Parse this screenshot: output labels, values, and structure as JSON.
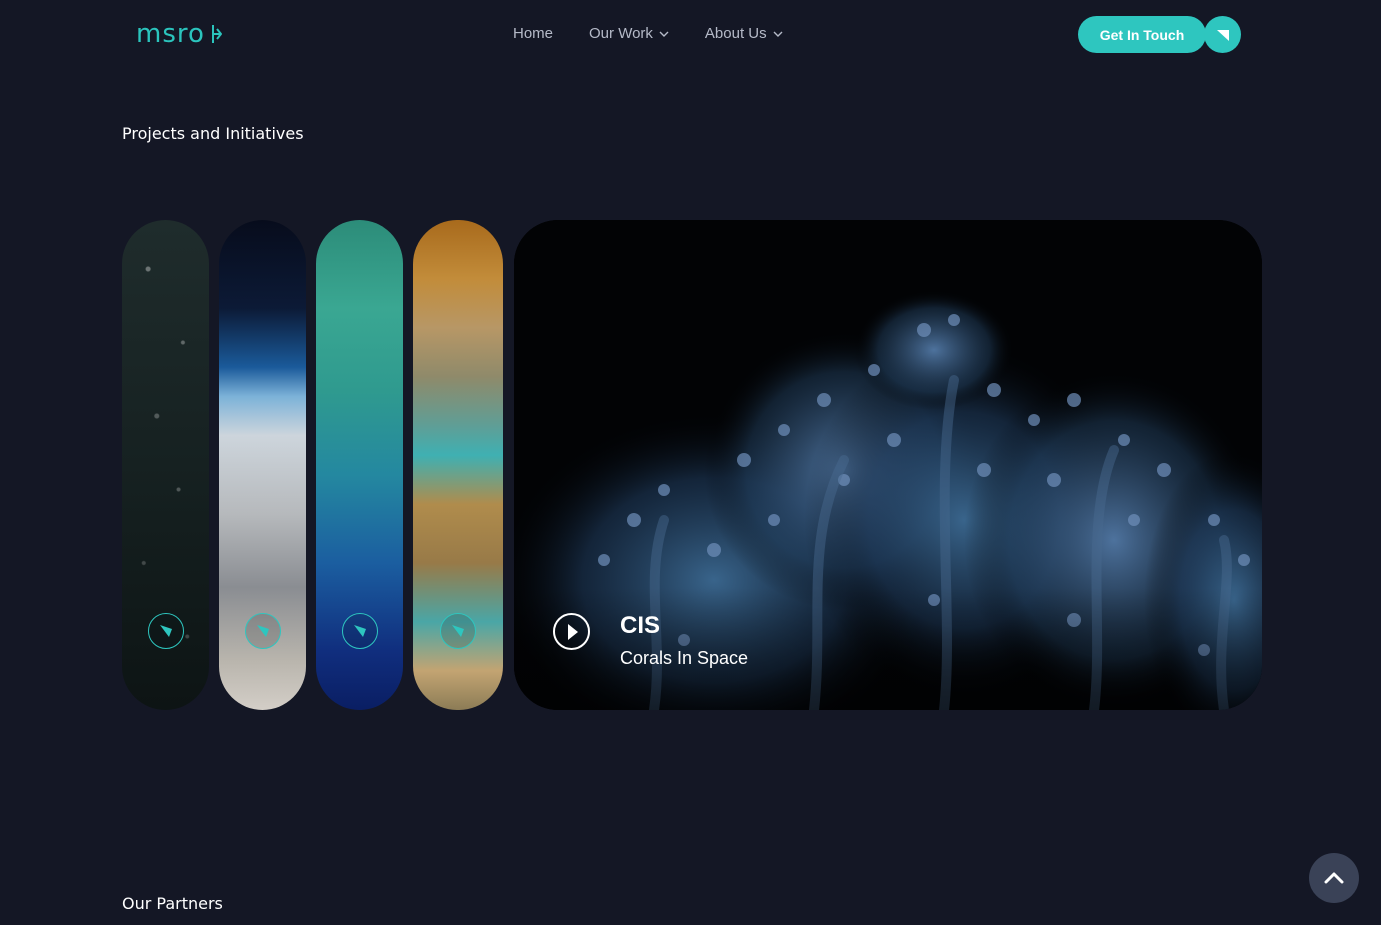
{
  "header": {
    "logo_text": "msro",
    "nav": [
      {
        "label": "Home",
        "has_dropdown": false
      },
      {
        "label": "Our Work",
        "has_dropdown": true
      },
      {
        "label": "About Us",
        "has_dropdown": true
      }
    ],
    "cta_label": "Get In Touch"
  },
  "sections": {
    "projects_title": "Projects and Initiatives",
    "partners_title": "Our Partners"
  },
  "projects": {
    "strips": [
      {
        "icon": "arrow-icon"
      },
      {
        "icon": "arrow-icon"
      },
      {
        "icon": "arrow-icon"
      },
      {
        "icon": "arrow-icon"
      }
    ],
    "featured": {
      "title": "CIS",
      "subtitle": "Corals In Space",
      "icon": "play-icon"
    }
  },
  "colors": {
    "background": "#141725",
    "accent": "#2ec6bf",
    "nav_text": "#b5bac8",
    "scroll_button": "#3a4257"
  }
}
